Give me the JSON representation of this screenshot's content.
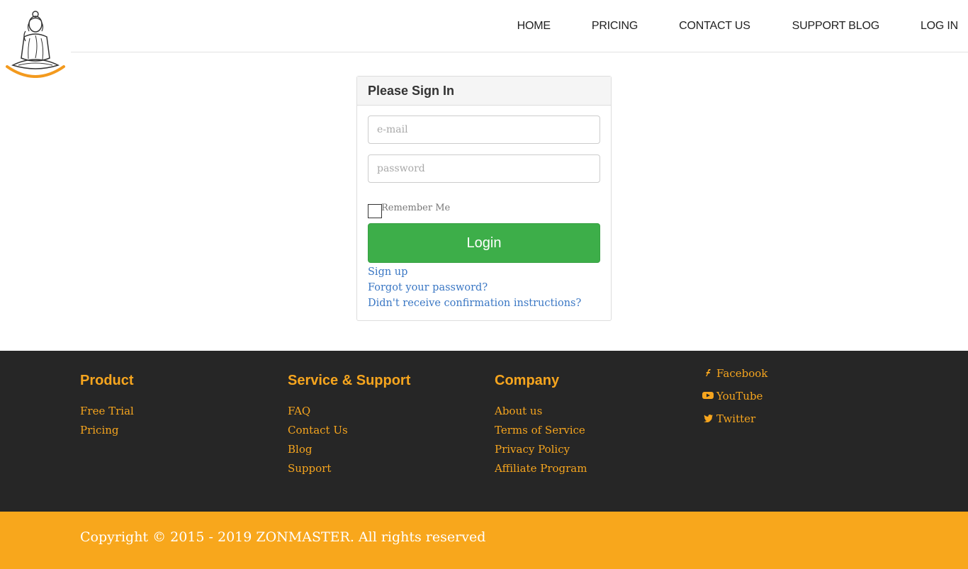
{
  "header": {
    "logo_alt": "Buddha logo",
    "nav": [
      {
        "label": "HOME"
      },
      {
        "label": "PRICING"
      },
      {
        "label": "CONTACT US"
      },
      {
        "label": "SUPPORT BLOG"
      },
      {
        "label": "LOG IN"
      }
    ]
  },
  "signin": {
    "title": "Please Sign In",
    "email_placeholder": "e-mail",
    "password_placeholder": "password",
    "remember_label": "Remember Me",
    "remember_checked": false,
    "login_label": "Login",
    "links": {
      "signup": "Sign up",
      "forgot": "Forgot your password?",
      "confirm": "Didn't receive confirmation instructions?"
    }
  },
  "footer": {
    "product": {
      "heading": "Product",
      "links": [
        "Free Trial",
        "Pricing"
      ]
    },
    "support": {
      "heading": "Service & Support",
      "links": [
        "FAQ",
        "Contact Us",
        "Blog",
        "Support"
      ]
    },
    "company": {
      "heading": "Company",
      "links": [
        "About us",
        "Terms of Service",
        "Privacy Policy",
        "Affiliate Program"
      ]
    },
    "social": [
      {
        "label": "Facebook",
        "icon": "facebook-icon"
      },
      {
        "label": "YouTube",
        "icon": "youtube-icon"
      },
      {
        "label": "Twitter",
        "icon": "twitter-icon"
      }
    ],
    "copyright": "Copyright © 2015 - 2019 ZONMASTER. All rights reserved"
  },
  "colors": {
    "accent": "#f8a71c",
    "login_button": "#3dae49",
    "link": "#3a77c4",
    "footer_bg": "#262626"
  }
}
